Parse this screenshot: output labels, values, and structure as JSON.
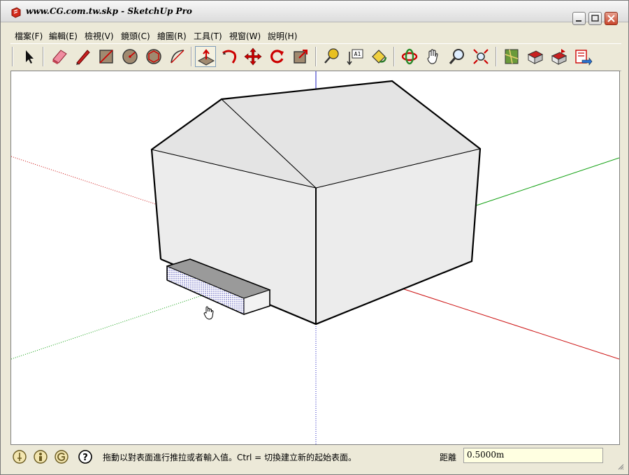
{
  "window": {
    "title": "www.CG.com.tw.skp - SketchUp Pro"
  },
  "menu": {
    "items": [
      {
        "label": "檔案(F)"
      },
      {
        "label": "編輯(E)"
      },
      {
        "label": "檢視(V)"
      },
      {
        "label": "鏡頭(C)"
      },
      {
        "label": "繪圖(R)"
      },
      {
        "label": "工具(T)"
      },
      {
        "label": "視窗(W)"
      },
      {
        "label": "說明(H)"
      }
    ]
  },
  "toolbar": {
    "tools": [
      {
        "icon": "select-arrow-icon"
      },
      {
        "icon": "eraser-icon"
      },
      {
        "icon": "pencil-line-icon"
      },
      {
        "icon": "rectangle-icon"
      },
      {
        "icon": "circle-icon"
      },
      {
        "icon": "polygon-icon"
      },
      {
        "icon": "arc-icon"
      },
      {
        "icon": "push-pull-icon",
        "active": true
      },
      {
        "icon": "follow-me-icon"
      },
      {
        "icon": "move-icon"
      },
      {
        "icon": "rotate-icon"
      },
      {
        "icon": "scale-icon"
      },
      {
        "icon": "tape-measure-icon"
      },
      {
        "icon": "dimension-icon"
      },
      {
        "icon": "paint-bucket-icon"
      },
      {
        "icon": "orbit-icon"
      },
      {
        "icon": "pan-hand-icon"
      },
      {
        "icon": "zoom-icon"
      },
      {
        "icon": "zoom-extents-icon"
      },
      {
        "icon": "google-earth-icon"
      },
      {
        "icon": "get-models-icon"
      },
      {
        "icon": "share-model-icon"
      },
      {
        "icon": "export-icon"
      }
    ],
    "dimension_text": "A1"
  },
  "statusbar": {
    "icons": [
      "geo-location-icon",
      "credits-icon",
      "google-signin-icon",
      "help-icon"
    ],
    "help_glyph": "?",
    "message": "拖動以對表面進行推拉或者輸入值。Ctrl = 切換建立新的起始表面。",
    "measure_label": "距離",
    "measure_value": "0.5000m"
  },
  "colors": {
    "axis_red": "#cc1010",
    "axis_green": "#10a010",
    "axis_blue": "#2020c0",
    "face": "#ececec",
    "roof": "#e4e4e4",
    "selected_face": "#9a9a9a"
  }
}
